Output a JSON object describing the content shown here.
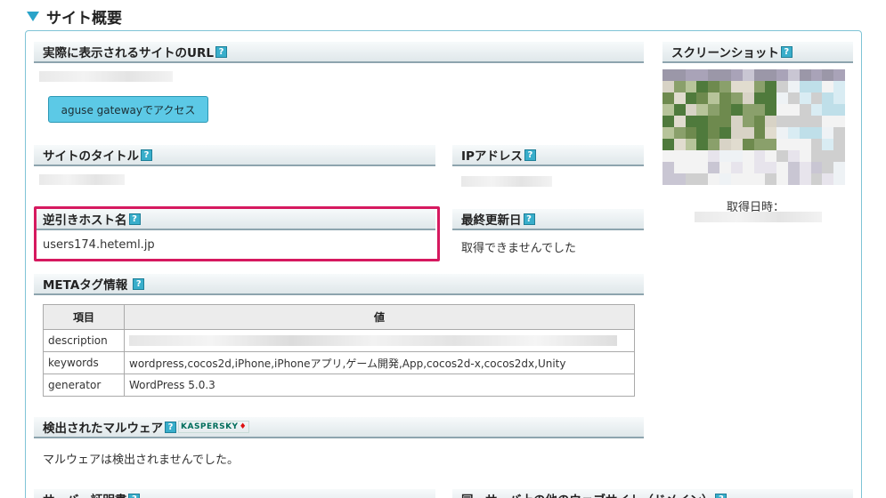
{
  "page_title": "サイト概要",
  "sections": {
    "url": {
      "label": "実際に表示されるサイトのURL",
      "help": "?"
    },
    "gateway_button": "aguse gatewayでアクセス",
    "screenshot": {
      "label": "スクリーンショット",
      "help": "?",
      "captured_label": "取得日時："
    },
    "site_title": {
      "label": "サイトのタイトル",
      "help": "?"
    },
    "ip_address": {
      "label": "IPアドレス",
      "help": "?"
    },
    "reverse_host": {
      "label": "逆引きホスト名",
      "help": "?",
      "value": "users174.heteml.jp"
    },
    "last_updated": {
      "label": "最終更新日",
      "help": "?",
      "value": "取得できませんでした"
    },
    "meta": {
      "label": "METAタグ情報",
      "help": "?",
      "columns": [
        "項目",
        "値"
      ],
      "rows": [
        {
          "key": "description",
          "value": ""
        },
        {
          "key": "keywords",
          "value": "wordpress,cocos2d,iPhone,iPhoneアプリ,ゲーム開発,App,cocos2d-x,cocos2dx,Unity"
        },
        {
          "key": "generator",
          "value": "WordPress 5.0.3"
        }
      ]
    },
    "malware": {
      "label": "検出されたマルウェア",
      "help": "?",
      "badge": "KASPERSKY",
      "value": "マルウェアは検出されませんでした。"
    },
    "bottom_left": {
      "label": "サーバー証明書",
      "help": "?"
    },
    "bottom_right": {
      "label": "同一サーバ上の他のウェブサイト（ドメイン）",
      "help": "?"
    }
  },
  "colors": {
    "accent": "#2aa3c9",
    "highlight": "#d6195f",
    "button": "#5cc9e6"
  }
}
